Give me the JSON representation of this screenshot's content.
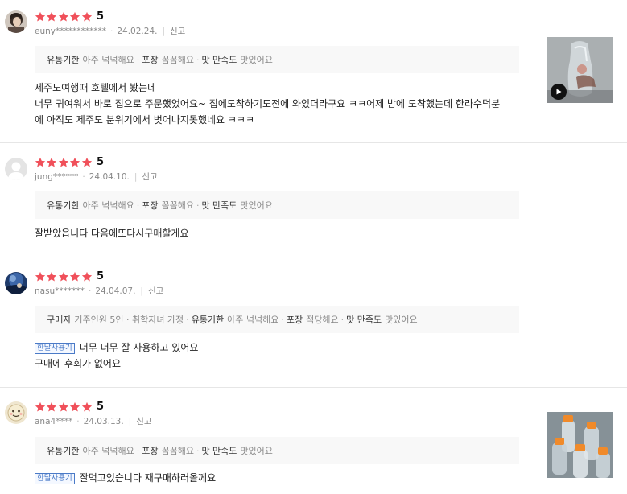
{
  "reviews": [
    {
      "score": "5",
      "rating": 5,
      "user": "euny************",
      "date": "24.02.24.",
      "report": "신고",
      "attributes": [
        {
          "key": "유통기한",
          "value": "아주 넉넉해요"
        },
        {
          "key": "포장",
          "value": "꼼꼼해요"
        },
        {
          "key": "맛 만족도",
          "value": "맛있어요"
        }
      ],
      "tag": "",
      "text_lines": [
        "제주도여행때 호텔에서 봤는데",
        "너무 귀여워서 바로 집으로 주문했었어요~ 집에도착하기도전에 와있더라구요 ㅋㅋ어제 밤에 도착했는데 한라수덕분",
        "에 아직도 제주도 분위기에서 벗어나지못했네요 ㅋㅋㅋ"
      ],
      "has_video": true
    },
    {
      "score": "5",
      "rating": 5,
      "user": "jung******",
      "date": "24.04.10.",
      "report": "신고",
      "attributes": [
        {
          "key": "유통기한",
          "value": "아주 넉넉해요"
        },
        {
          "key": "포장",
          "value": "꼼꼼해요"
        },
        {
          "key": "맛 만족도",
          "value": "맛있어요"
        }
      ],
      "tag": "",
      "text_lines": [
        "잘받았읍니다 다음에또다시구매할게요"
      ]
    },
    {
      "score": "5",
      "rating": 5,
      "user": "nasu*******",
      "date": "24.04.07.",
      "report": "신고",
      "attributes": [
        {
          "key": "구매자",
          "value": "거주인원 5인 · 취학자녀 가정"
        },
        {
          "key": "유통기한",
          "value": "아주 넉넉해요"
        },
        {
          "key": "포장",
          "value": "적당해요"
        },
        {
          "key": "맛 만족도",
          "value": "맛있어요"
        }
      ],
      "tag": "한달사용기",
      "text_lines": [
        "너무 너무 잘 사용하고 있어요",
        "구매에 후회가 없어요"
      ]
    },
    {
      "score": "5",
      "rating": 5,
      "user": "ana4****",
      "date": "24.03.13.",
      "report": "신고",
      "attributes": [
        {
          "key": "유통기한",
          "value": "아주 넉넉해요"
        },
        {
          "key": "포장",
          "value": "꼼꼼해요"
        },
        {
          "key": "맛 만족도",
          "value": "맛있어요"
        }
      ],
      "tag": "한달사용기",
      "text_lines": [
        "잘먹고있습니다 재구매하러올께요"
      ]
    }
  ],
  "colors": {
    "star": "#f0505a",
    "tag": "#4a7ac7",
    "attr_bg": "#f8f8f8"
  }
}
